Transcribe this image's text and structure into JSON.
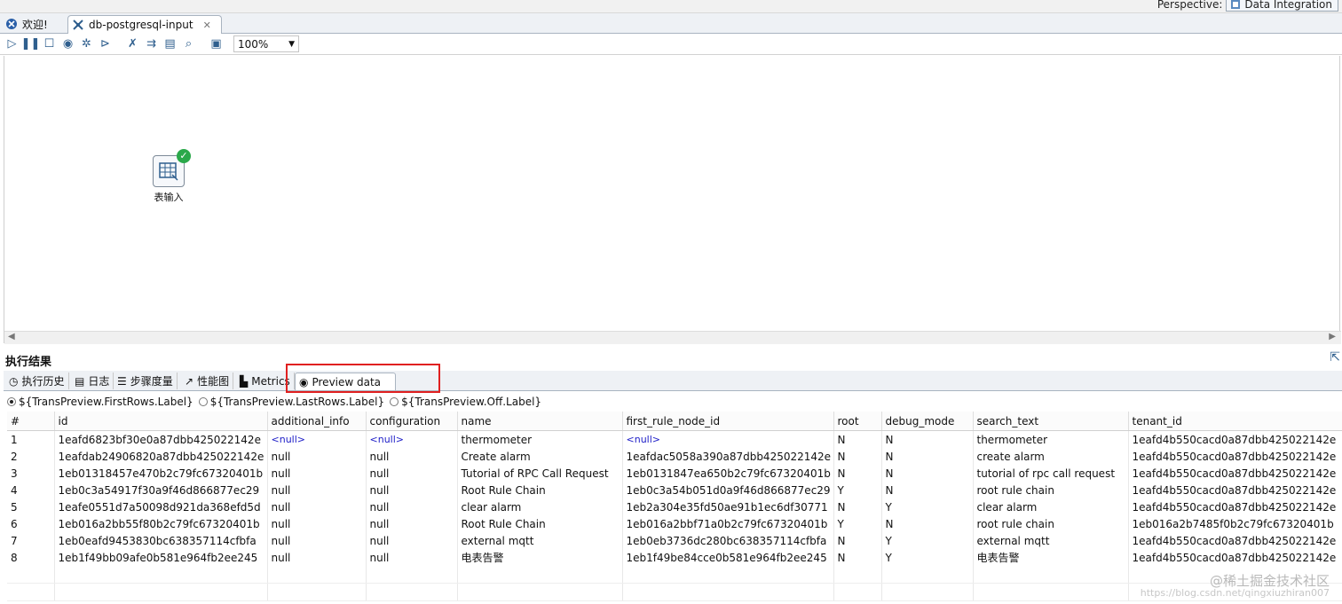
{
  "perspective": {
    "label": "Perspective:",
    "value": "Data Integration"
  },
  "tabs": [
    {
      "label": "欢迎!"
    },
    {
      "label": "db-postgresql-input"
    }
  ],
  "toolbar": {
    "zoom": "100%"
  },
  "step": {
    "label": "表输入"
  },
  "results": {
    "title": "执行结果",
    "tabs": [
      "执行历史",
      "日志",
      "步骤度量",
      "性能图",
      "Metrics",
      "Preview data"
    ],
    "radios": [
      "${TransPreview.FirstRows.Label}",
      "${TransPreview.LastRows.Label}",
      "${TransPreview.Off.Label}"
    ]
  },
  "table": {
    "columns": [
      "#",
      "id",
      "additional_info",
      "configuration",
      "name",
      "first_rule_node_id",
      "root",
      "debug_mode",
      "search_text",
      "tenant_id"
    ],
    "rows": [
      [
        "1",
        "1eafd6823bf30e0a87dbb425022142e",
        "<null>",
        "<null>",
        "thermometer",
        "<null>",
        "N",
        "N",
        "thermometer",
        "1eafd4b550cacd0a87dbb425022142e"
      ],
      [
        "2",
        "1eafdab24906820a87dbb425022142e",
        "null",
        "null",
        "Create alarm",
        "1eafdac5058a390a87dbb425022142e",
        "N",
        "N",
        "create alarm",
        "1eafd4b550cacd0a87dbb425022142e"
      ],
      [
        "3",
        "1eb01318457e470b2c79fc67320401b",
        "null",
        "null",
        "Tutorial of RPC Call Request",
        "1eb0131847ea650b2c79fc67320401b",
        "N",
        "N",
        "tutorial of rpc call request",
        "1eafd4b550cacd0a87dbb425022142e"
      ],
      [
        "4",
        "1eb0c3a54917f30a9f46d866877ec29",
        "null",
        "null",
        "Root Rule Chain",
        "1eb0c3a54b051d0a9f46d866877ec29",
        "Y",
        "N",
        "root rule chain",
        "1eafd4b550cacd0a87dbb425022142e"
      ],
      [
        "5",
        "1eafe0551d7a50098d921da368efd5d",
        "null",
        "null",
        "clear alarm",
        "1eb2a304e35fd50ae91b1ec6df30771",
        "N",
        "Y",
        "clear alarm",
        "1eafd4b550cacd0a87dbb425022142e"
      ],
      [
        "6",
        "1eb016a2bb55f80b2c79fc67320401b",
        "null",
        "null",
        "Root Rule Chain",
        "1eb016a2bbf71a0b2c79fc67320401b",
        "Y",
        "N",
        "root rule chain",
        "1eb016a2b7485f0b2c79fc67320401b"
      ],
      [
        "7",
        "1eb0eafd9453830bc638357114cfbfa",
        "null",
        "null",
        "external mqtt",
        "1eb0eb3736dc280bc638357114cfbfa",
        "N",
        "Y",
        "external mqtt",
        "1eafd4b550cacd0a87dbb425022142e"
      ],
      [
        "8",
        "1eb1f49bb09afe0b581e964fb2ee245",
        "null",
        "null",
        "电表告警",
        "1eb1f49be84cce0b581e964fb2ee245",
        "N",
        "Y",
        "电表告警",
        "1eafd4b550cacd0a87dbb425022142e"
      ]
    ]
  },
  "watermark": {
    "text": "@稀土掘金技术社区",
    "url": "https://blog.csdn.net/qingxiuzhiran007"
  }
}
